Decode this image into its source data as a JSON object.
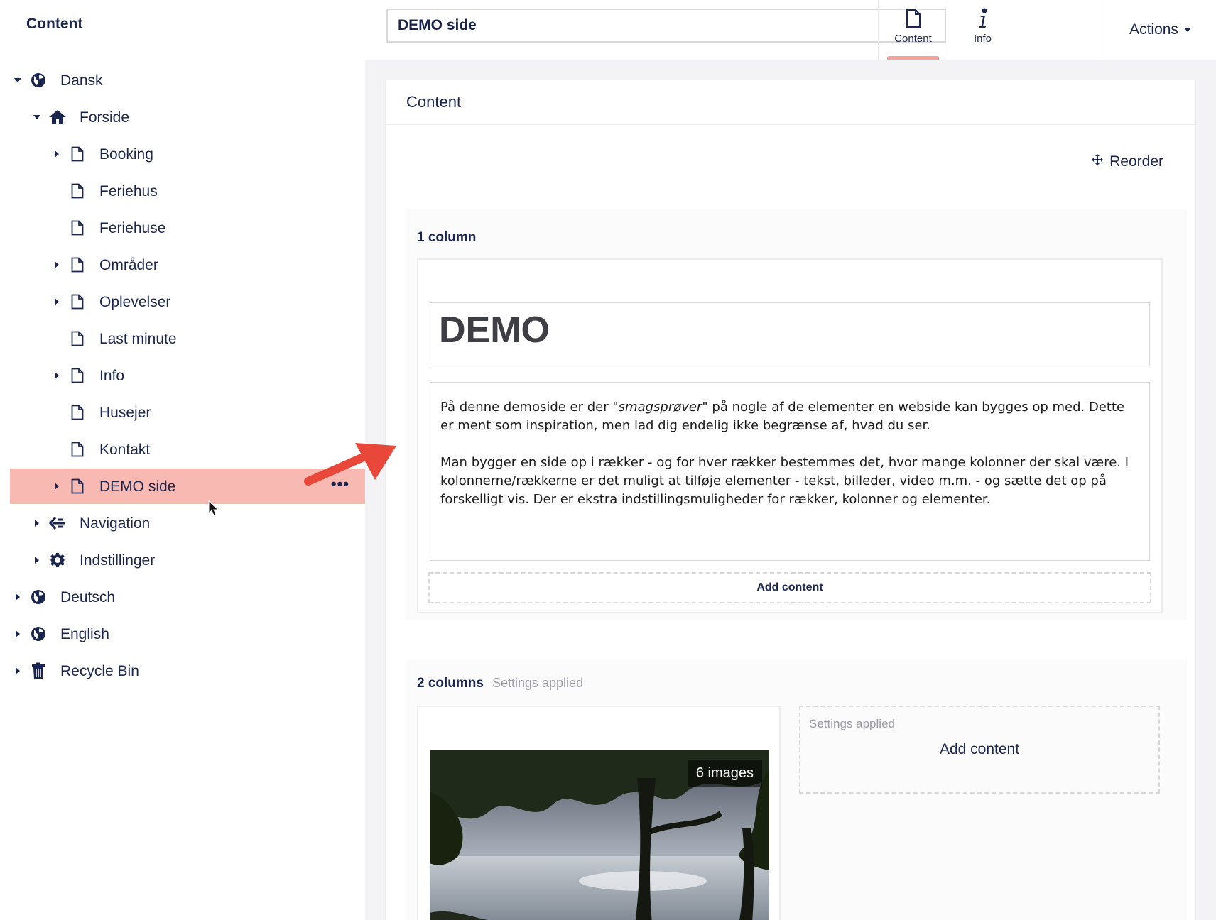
{
  "sidebar": {
    "title": "Content",
    "tree": [
      {
        "label": "Dansk",
        "icon": "globe-icon",
        "level": 0,
        "caret": "down",
        "active": false
      },
      {
        "label": "Forside",
        "icon": "home-icon",
        "level": 1,
        "caret": "down",
        "active": false
      },
      {
        "label": "Booking",
        "icon": "document-icon",
        "level": 2,
        "caret": "right",
        "active": false
      },
      {
        "label": "Feriehus",
        "icon": "document-icon",
        "level": 2,
        "caret": "none",
        "active": false
      },
      {
        "label": "Feriehuse",
        "icon": "document-icon",
        "level": 2,
        "caret": "none",
        "active": false
      },
      {
        "label": "Områder",
        "icon": "document-icon",
        "level": 2,
        "caret": "right",
        "active": false
      },
      {
        "label": "Oplevelser",
        "icon": "document-icon",
        "level": 2,
        "caret": "right",
        "active": false
      },
      {
        "label": "Last minute",
        "icon": "document-icon",
        "level": 2,
        "caret": "none",
        "active": false
      },
      {
        "label": "Info",
        "icon": "document-icon",
        "level": 2,
        "caret": "right",
        "active": false
      },
      {
        "label": "Husejer",
        "icon": "document-icon",
        "level": 2,
        "caret": "none",
        "active": false
      },
      {
        "label": "Kontakt",
        "icon": "document-icon",
        "level": 2,
        "caret": "none",
        "active": false
      },
      {
        "label": "DEMO side",
        "icon": "document-icon",
        "level": 2,
        "caret": "right",
        "active": true,
        "dots": "•••"
      },
      {
        "label": "Navigation",
        "icon": "navigation-icon",
        "level": 1,
        "caret": "right",
        "active": false
      },
      {
        "label": "Indstillinger",
        "icon": "gear-icon",
        "level": 1,
        "caret": "right",
        "active": false
      },
      {
        "label": "Deutsch",
        "icon": "globe-icon",
        "level": 0,
        "caret": "right",
        "active": false
      },
      {
        "label": "English",
        "icon": "globe-icon",
        "level": 0,
        "caret": "right",
        "active": false
      },
      {
        "label": "Recycle Bin",
        "icon": "trash-icon",
        "level": 0,
        "caret": "right",
        "active": false
      }
    ]
  },
  "header": {
    "name_value": "DEMO side",
    "tabs": [
      {
        "label": "Content",
        "icon": "document-icon",
        "active": true
      },
      {
        "label": "Info",
        "icon": "info-icon",
        "active": false
      }
    ],
    "actions_label": "Actions"
  },
  "main": {
    "panel_title": "Content",
    "reorder_label": "Reorder",
    "row1": {
      "title": "1 column",
      "headline": "DEMO",
      "paragraph1_before": "På denne demoside er der ",
      "paragraph1_em": "\"smagsprøver\"",
      "paragraph1_after": " på nogle af de elementer en webside kan bygges op med. Dette er ment som inspiration, men lad dig endelig ikke begrænse af, hvad du ser.",
      "paragraph2": "Man bygger en side op i rækker - og for hver rækker bestemmes det, hvor mange kolonner der skal være. I kolonnerne/rækkerne er det muligt at tilføje elementer - tekst, billeder, video m.m. - og sætte det op på forskelligt vis. Der er ekstra indstillingsmuligheder for rækker, kolonner og elementer.",
      "add_content": "Add content"
    },
    "row2": {
      "title": "2 columns",
      "settings_note": "Settings applied",
      "image_badge": "6 images",
      "right_settings_note": "Settings applied",
      "right_add_content": "Add content"
    }
  },
  "colors": {
    "active_row": "#f8b9b3",
    "tab_indicator": "#f5a39a",
    "text_primary": "#1b264f",
    "arrow": "#e8483a"
  }
}
